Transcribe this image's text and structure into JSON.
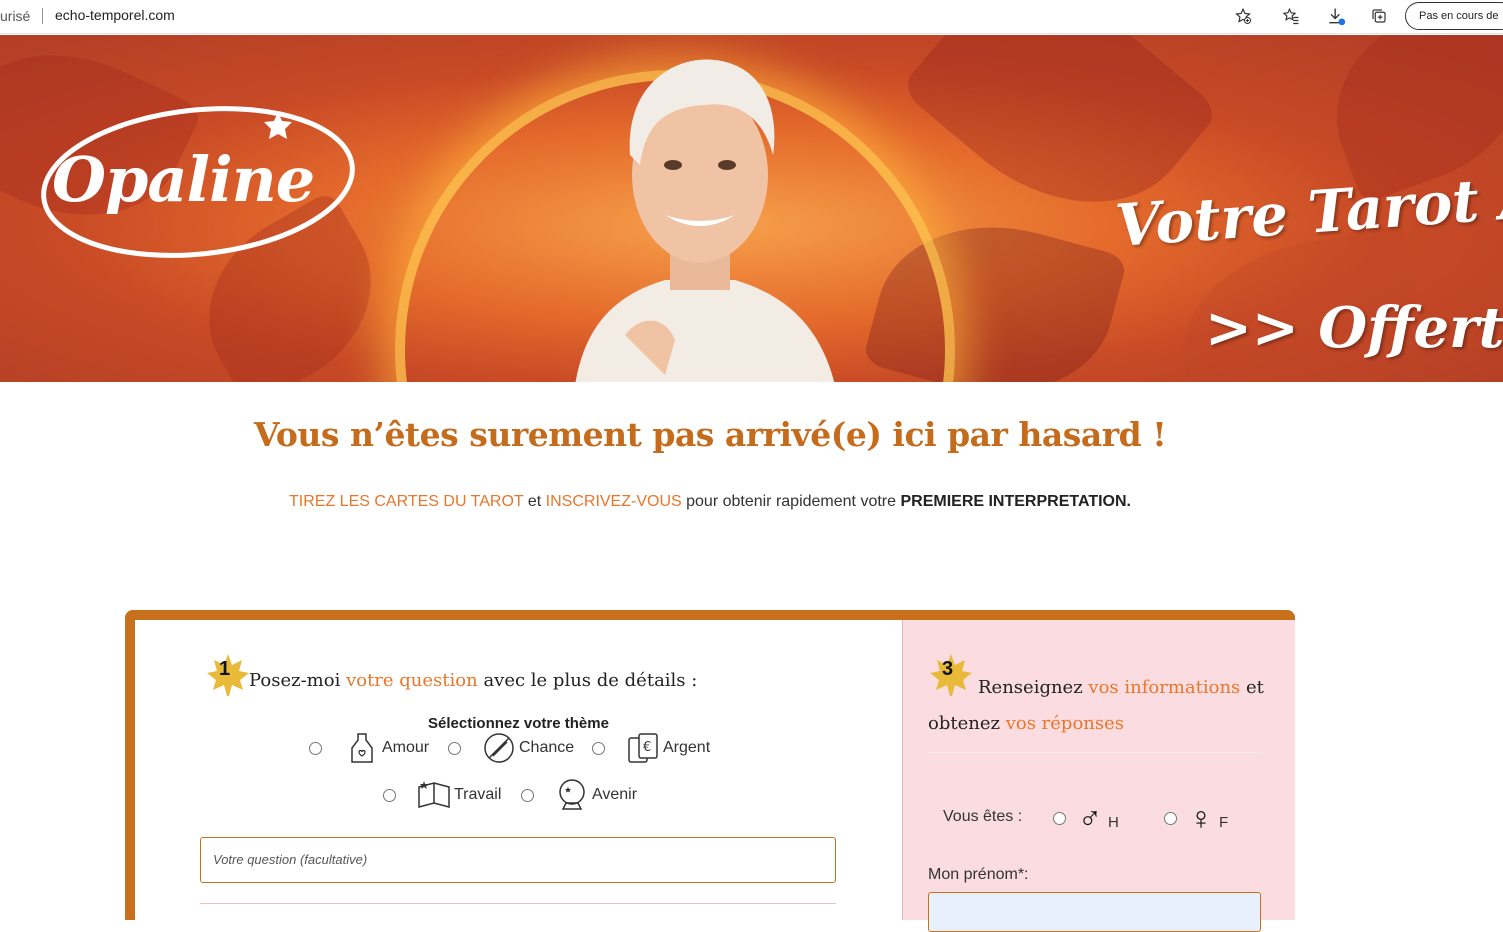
{
  "browser": {
    "lock_text": "urisé",
    "url": "echo-temporel.com",
    "profile_label": "Pas en cours de"
  },
  "banner": {
    "logo_text": "Opaline",
    "tagline_1": "Votre Tarot Am",
    "tagline_2": ">> Offert <<"
  },
  "hero": {
    "headline": "Vous n’êtes surement pas arrivé(e) ici par hasard !",
    "sub_accent_1": "TIREZ LES CARTES DU TAROT",
    "sub_text_1": " et ",
    "sub_accent_2": "INSCRIVEZ-VOUS",
    "sub_text_2": " pour obtenir rapidement votre ",
    "sub_bold": "PREMIERE INTERPRETATION."
  },
  "step1": {
    "number": "1",
    "title_pre": "Posez-moi ",
    "title_accent": "votre question",
    "title_post": " avec le plus de détails :",
    "theme_label": "Sélectionnez votre thème",
    "themes": [
      {
        "label": "Amour",
        "icon": "potion-bottle-icon"
      },
      {
        "label": "Chance",
        "icon": "clover-charm-icon"
      },
      {
        "label": "Argent",
        "icon": "money-cards-icon"
      },
      {
        "label": "Travail",
        "icon": "open-book-icon"
      },
      {
        "label": "Avenir",
        "icon": "crystal-ball-icon"
      }
    ],
    "question_placeholder": "Votre question (facultative)"
  },
  "step3": {
    "number": "3",
    "title_pre": "Renseignez ",
    "title_accent_1": "vos informations",
    "title_mid": " et obtenez ",
    "title_accent_2": "vos réponses",
    "gender_label": "Vous êtes :",
    "gender_options": [
      {
        "symbol": "♂",
        "label": "H"
      },
      {
        "symbol": "♀",
        "label": "F"
      }
    ],
    "prenom_label": "Mon prénom*:"
  },
  "colors": {
    "accent_orange": "#e8762b",
    "headline_brown": "#c46b1c",
    "card_border": "#c9701c",
    "right_panel_bg": "#fbdde1"
  }
}
